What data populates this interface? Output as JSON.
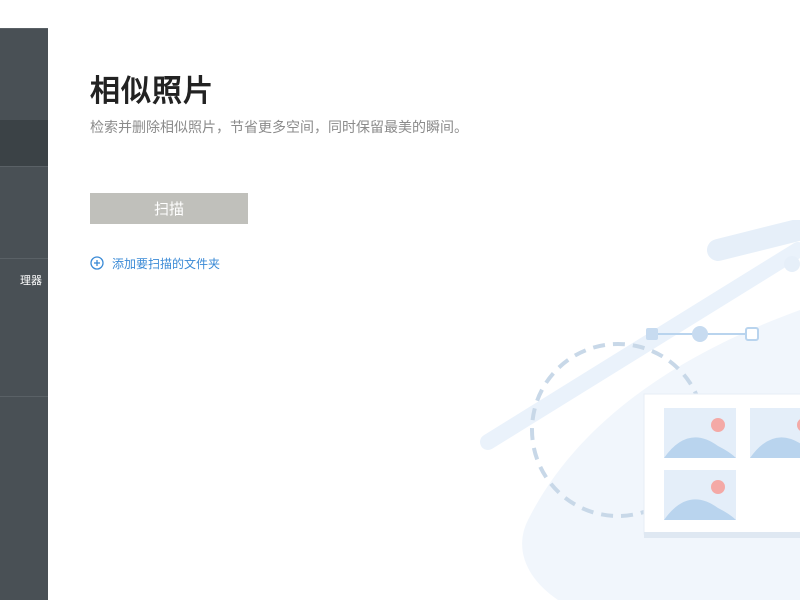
{
  "sidebar": {
    "partial_item_label": "理器"
  },
  "main": {
    "title": "相似照片",
    "subtitle": "检索并删除相似照片，节省更多空间，同时保留最美的瞬间。",
    "scan_button": "扫描",
    "add_folder_link": "添加要扫描的文件夹"
  },
  "colors": {
    "sidebar_bg": "#495055",
    "sidebar_selected": "#3b4246",
    "scan_button_bg": "#c0c0bb",
    "link": "#3a8ad6",
    "illustration_blue": "#b9d4ee",
    "illustration_dot": "#f4a9a6"
  },
  "icons": [
    "plus-circle-icon",
    "photo-icon",
    "pen-tool-icon"
  ]
}
